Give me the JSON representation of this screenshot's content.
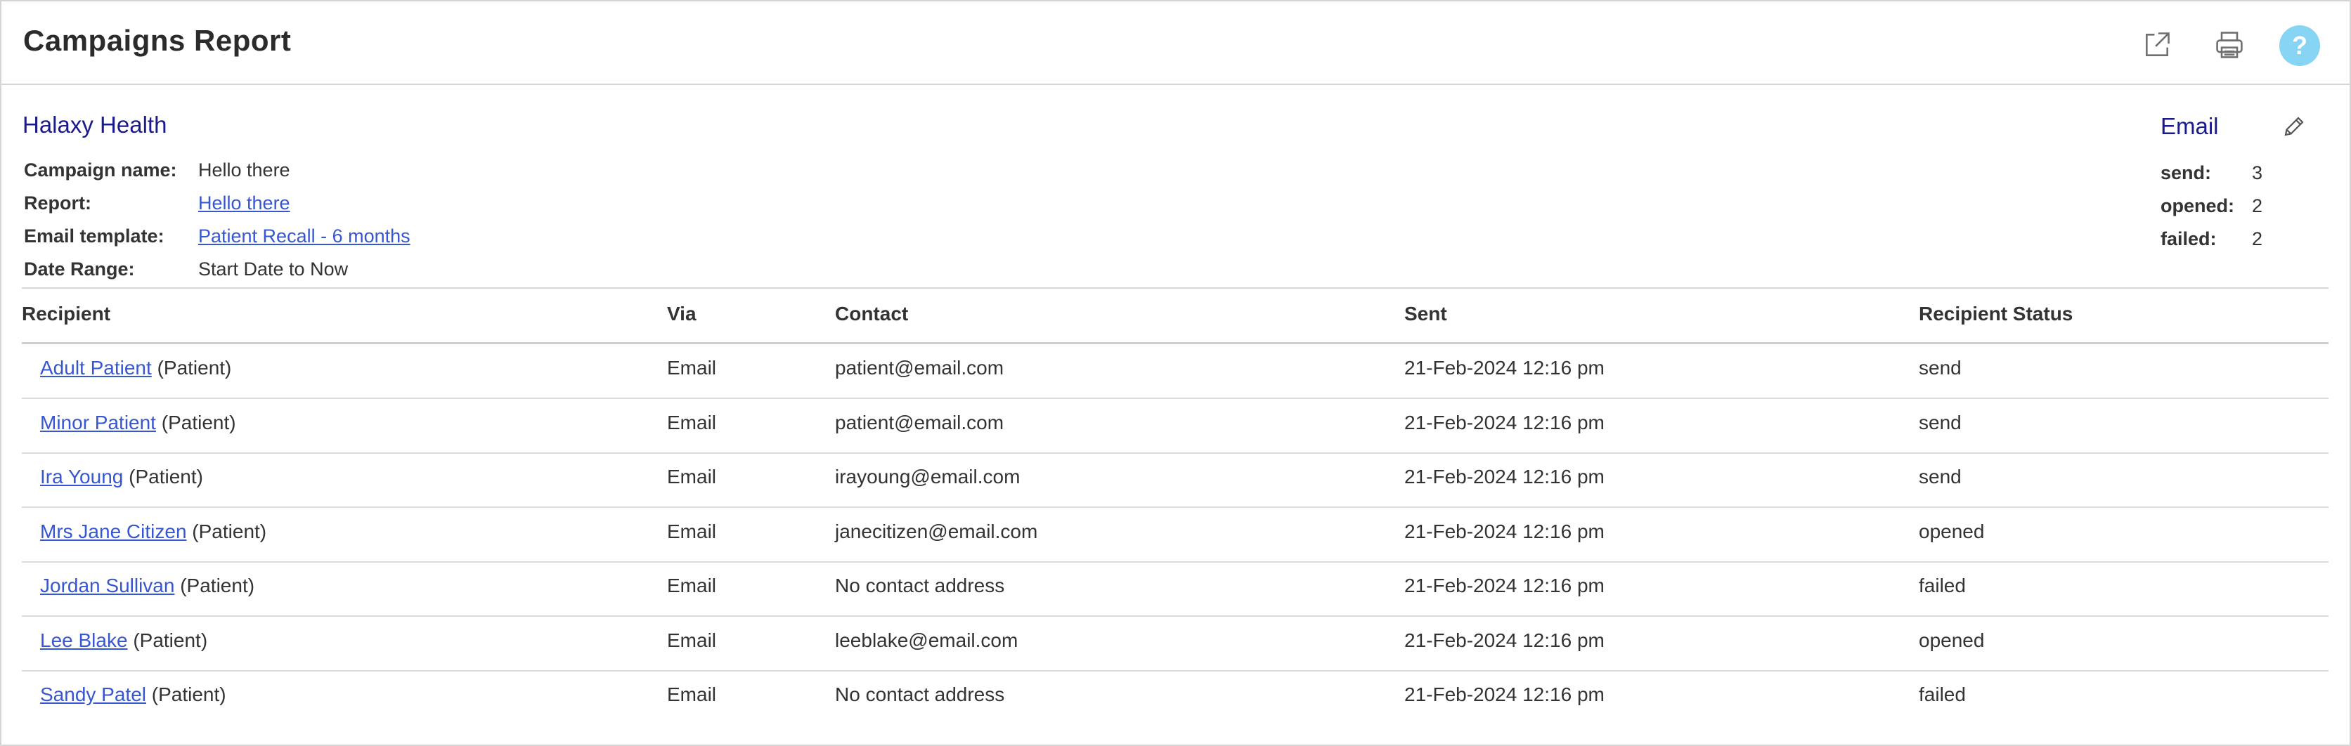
{
  "header": {
    "title": "Campaigns Report",
    "help_label": "?"
  },
  "organization": "Halaxy Health",
  "info": {
    "campaign_name_label": "Campaign name:",
    "campaign_name_value": "Hello there",
    "report_label": "Report:",
    "report_value": "Hello there",
    "template_label": "Email template:",
    "template_value": "Patient Recall - 6 months",
    "date_range_label": "Date Range:",
    "date_range_value": "Start Date to Now"
  },
  "stats": {
    "title": "Email",
    "items": [
      {
        "label": "send:",
        "value": "3"
      },
      {
        "label": "opened:",
        "value": "2"
      },
      {
        "label": "failed:",
        "value": "2"
      }
    ]
  },
  "table": {
    "columns": [
      "Recipient",
      "Via",
      "Contact",
      "Sent",
      "Recipient Status"
    ],
    "rows": [
      {
        "name": "Adult Patient",
        "type": "(Patient)",
        "via": "Email",
        "contact": "patient@email.com",
        "contact_missing": false,
        "sent": "21-Feb-2024 12:16 pm",
        "status": "send"
      },
      {
        "name": "Minor Patient",
        "type": "(Patient)",
        "via": "Email",
        "contact": "patient@email.com",
        "contact_missing": false,
        "sent": "21-Feb-2024 12:16 pm",
        "status": "send"
      },
      {
        "name": "Ira Young",
        "type": "(Patient)",
        "via": "Email",
        "contact": "irayoung@email.com",
        "contact_missing": false,
        "sent": "21-Feb-2024 12:16 pm",
        "status": "send"
      },
      {
        "name": "Mrs Jane Citizen",
        "type": "(Patient)",
        "via": "Email",
        "contact": "janecitizen@email.com",
        "contact_missing": false,
        "sent": "21-Feb-2024 12:16 pm",
        "status": "opened"
      },
      {
        "name": "Jordan Sullivan",
        "type": "(Patient)",
        "via": "Email",
        "contact": "No contact address",
        "contact_missing": true,
        "sent": "21-Feb-2024 12:16 pm",
        "status": "failed"
      },
      {
        "name": "Lee Blake",
        "type": "(Patient)",
        "via": "Email",
        "contact": "leeblake@email.com",
        "contact_missing": false,
        "sent": "21-Feb-2024 12:16 pm",
        "status": "opened"
      },
      {
        "name": "Sandy Patel",
        "type": "(Patient)",
        "via": "Email",
        "contact": "No contact address",
        "contact_missing": true,
        "sent": "21-Feb-2024 12:16 pm",
        "status": "failed"
      }
    ]
  },
  "colors": {
    "link": "#3756d1",
    "heading_blue": "#1a1a8c",
    "help_button": "#87d4f4",
    "muted_text": "#c4c4c4"
  }
}
